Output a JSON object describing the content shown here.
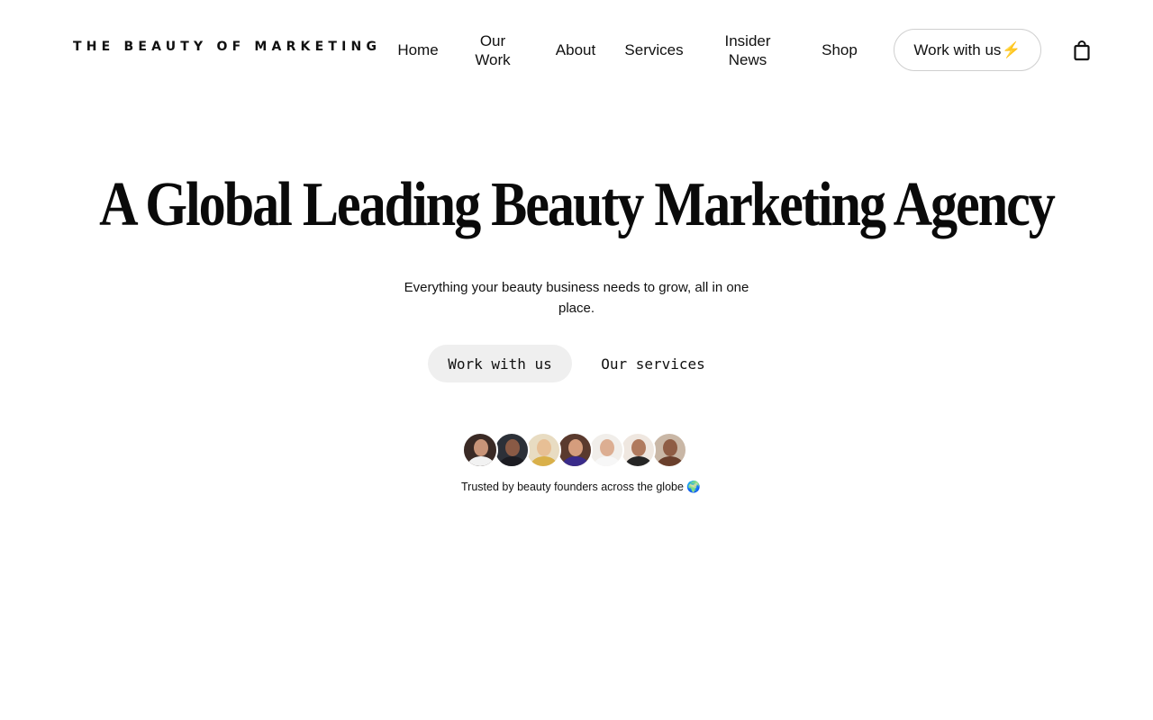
{
  "header": {
    "logo": "THE BEAUTY OF MARKETING",
    "nav": {
      "home": "Home",
      "our_work": "Our Work",
      "about": "About",
      "services": "Services",
      "insider_news": "Insider News",
      "shop": "Shop"
    },
    "cta_label": "Work with us",
    "cta_emoji": "⚡",
    "cart_icon": "shopping-bag-icon"
  },
  "hero": {
    "title": "A Global Leading Beauty Marketing Agency",
    "subtitle": "Everything your beauty business needs to grow, all in one place.",
    "primary_button": "Work with us",
    "secondary_button": "Our services",
    "trusted_text": "Trusted by beauty founders across the globe",
    "trusted_emoji": "🌍"
  },
  "avatars": [
    {
      "name": "founder-avatar-1",
      "bg": "#3a2a25",
      "face": "#c89478",
      "body": "#f2f2f2"
    },
    {
      "name": "founder-avatar-2",
      "bg": "#2c3038",
      "face": "#8a5a45",
      "body": "#1c1c22"
    },
    {
      "name": "founder-avatar-3",
      "bg": "#e8dcc2",
      "face": "#e7bf95",
      "body": "#d9b04a"
    },
    {
      "name": "founder-avatar-4",
      "bg": "#5a3a2e",
      "face": "#d59d7d",
      "body": "#3a2b8a"
    },
    {
      "name": "founder-avatar-5",
      "bg": "#f1eeea",
      "face": "#dcae92",
      "body": "#f7f7f7"
    },
    {
      "name": "founder-avatar-6",
      "bg": "#efe7e0",
      "face": "#b07a5e",
      "body": "#252525"
    },
    {
      "name": "founder-avatar-7",
      "bg": "#c9b7a6",
      "face": "#8e5c44",
      "body": "#6a3f2c"
    }
  ]
}
